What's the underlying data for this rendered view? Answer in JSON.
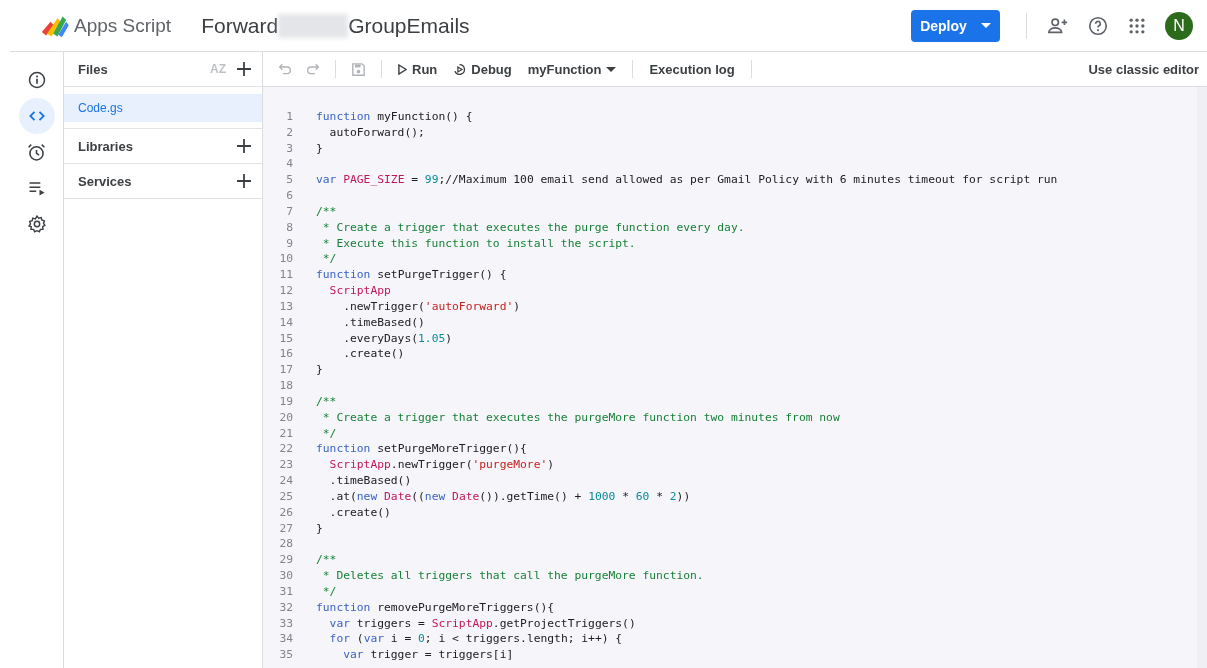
{
  "header": {
    "app_name": "Apps Script",
    "project_title_parts": [
      "Forward",
      "GroupEmails"
    ],
    "deploy_button": "Deploy",
    "avatar_initial": "N"
  },
  "rail": [
    {
      "kind": "info",
      "selected": false
    },
    {
      "kind": "code",
      "selected": true
    },
    {
      "kind": "triggers",
      "selected": false
    },
    {
      "kind": "executions",
      "selected": false
    },
    {
      "kind": "settings",
      "selected": false
    }
  ],
  "files_panel": {
    "title": "Files",
    "sort_label": "AZ",
    "files": [
      {
        "name": "Code.gs",
        "selected": true
      }
    ],
    "sections": [
      "Libraries",
      "Services"
    ]
  },
  "toolbar": {
    "run": "Run",
    "debug": "Debug",
    "function_select": "myFunction",
    "execution_log": "Execution log",
    "classic_editor": "Use classic editor"
  },
  "code_lines": [
    {
      "n": "1",
      "tokens": [
        {
          "kind": "kw",
          "text": "function"
        },
        {
          "kind": "plain",
          "text": " myFunction() {"
        }
      ]
    },
    {
      "n": "2",
      "tokens": [
        {
          "kind": "plain",
          "text": "  autoForward();"
        }
      ]
    },
    {
      "n": "3",
      "tokens": [
        {
          "kind": "plain",
          "text": "}"
        }
      ]
    },
    {
      "n": "4"
    },
    {
      "n": "5",
      "tokens": [
        {
          "kind": "kw",
          "text": "var "
        },
        {
          "kind": "cls",
          "text": "PAGE_SIZE"
        },
        {
          "kind": "plain",
          "text": " = "
        },
        {
          "kind": "num",
          "text": "99"
        },
        {
          "kind": "plain",
          "text": ";"
        },
        {
          "kind": "plaincomment",
          "text": "//Maximum 100 email send allowed as per Gmail Policy with 6 minutes timeout for script run"
        }
      ]
    },
    {
      "n": "6"
    },
    {
      "n": "7",
      "tokens": [
        {
          "kind": "comment",
          "text": "/**"
        }
      ]
    },
    {
      "n": "8",
      "tokens": [
        {
          "kind": "comment",
          "text": " * Create a trigger that executes the purge function every day."
        }
      ]
    },
    {
      "n": "9",
      "tokens": [
        {
          "kind": "comment",
          "text": " * Execute this function to install the script."
        }
      ]
    },
    {
      "n": "10",
      "tokens": [
        {
          "kind": "comment",
          "text": " */"
        }
      ]
    },
    {
      "n": "11",
      "tokens": [
        {
          "kind": "kw",
          "text": "function"
        },
        {
          "kind": "plain",
          "text": " setPurgeTrigger() {"
        }
      ]
    },
    {
      "n": "12",
      "tokens": [
        {
          "kind": "cls",
          "text": "  ScriptApp"
        }
      ]
    },
    {
      "n": "13",
      "tokens": [
        {
          "kind": "plain",
          "text": "    .newTrigger("
        },
        {
          "kind": "str",
          "text": "'autoForward'"
        },
        {
          "kind": "plain",
          "text": ")"
        }
      ]
    },
    {
      "n": "14",
      "tokens": [
        {
          "kind": "plain",
          "text": "    .timeBased()"
        }
      ]
    },
    {
      "n": "15",
      "tokens": [
        {
          "kind": "plain",
          "text": "    .everyDays("
        },
        {
          "kind": "num",
          "text": "1.05"
        },
        {
          "kind": "plain",
          "text": ")"
        }
      ]
    },
    {
      "n": "16",
      "tokens": [
        {
          "kind": "plain",
          "text": "    .create()"
        }
      ]
    },
    {
      "n": "17",
      "tokens": [
        {
          "kind": "plain",
          "text": "}"
        }
      ]
    },
    {
      "n": "18"
    },
    {
      "n": "19",
      "tokens": [
        {
          "kind": "comment",
          "text": "/**"
        }
      ]
    },
    {
      "n": "20",
      "tokens": [
        {
          "kind": "comment",
          "text": " * Create a trigger that executes the purgeMore function two minutes from now"
        }
      ]
    },
    {
      "n": "21",
      "tokens": [
        {
          "kind": "comment",
          "text": " */"
        }
      ]
    },
    {
      "n": "22",
      "tokens": [
        {
          "kind": "kw",
          "text": "function"
        },
        {
          "kind": "plain",
          "text": " setPurgeMoreTrigger(){"
        }
      ]
    },
    {
      "n": "23",
      "tokens": [
        {
          "kind": "cls",
          "text": "  ScriptApp"
        },
        {
          "kind": "plain",
          "text": ".newTrigger("
        },
        {
          "kind": "str",
          "text": "'purgeMore'"
        },
        {
          "kind": "plain",
          "text": ")"
        }
      ]
    },
    {
      "n": "24",
      "tokens": [
        {
          "kind": "plain",
          "text": "  .timeBased()"
        }
      ]
    },
    {
      "n": "25",
      "tokens": [
        {
          "kind": "plain",
          "text": "  .at("
        },
        {
          "kind": "kw",
          "text": "new "
        },
        {
          "kind": "cls",
          "text": "Date"
        },
        {
          "kind": "plain",
          "text": "(("
        },
        {
          "kind": "kw",
          "text": "new "
        },
        {
          "kind": "cls",
          "text": "Date"
        },
        {
          "kind": "plain",
          "text": "()).getTime() + "
        },
        {
          "kind": "num",
          "text": "1000"
        },
        {
          "kind": "plain",
          "text": " * "
        },
        {
          "kind": "num",
          "text": "60"
        },
        {
          "kind": "plain",
          "text": " * "
        },
        {
          "kind": "num",
          "text": "2"
        },
        {
          "kind": "plain",
          "text": "))"
        }
      ]
    },
    {
      "n": "26",
      "tokens": [
        {
          "kind": "plain",
          "text": "  .create()"
        }
      ]
    },
    {
      "n": "27",
      "tokens": [
        {
          "kind": "plain",
          "text": "}"
        }
      ]
    },
    {
      "n": "28"
    },
    {
      "n": "29",
      "tokens": [
        {
          "kind": "comment",
          "text": "/**"
        }
      ]
    },
    {
      "n": "30",
      "tokens": [
        {
          "kind": "comment",
          "text": " * Deletes all triggers that call the purgeMore function."
        }
      ]
    },
    {
      "n": "31",
      "tokens": [
        {
          "kind": "comment",
          "text": " */"
        }
      ]
    },
    {
      "n": "32",
      "tokens": [
        {
          "kind": "kw",
          "text": "function"
        },
        {
          "kind": "plain",
          "text": " removePurgeMoreTriggers(){"
        }
      ]
    },
    {
      "n": "33",
      "tokens": [
        {
          "kind": "kw",
          "text": "  var"
        },
        {
          "kind": "plain",
          "text": " triggers = "
        },
        {
          "kind": "cls",
          "text": "ScriptApp"
        },
        {
          "kind": "plain",
          "text": ".getProjectTriggers()"
        }
      ]
    },
    {
      "n": "34",
      "tokens": [
        {
          "kind": "kw",
          "text": "  for"
        },
        {
          "kind": "plain",
          "text": " ("
        },
        {
          "kind": "kw",
          "text": "var"
        },
        {
          "kind": "plain",
          "text": " i = "
        },
        {
          "kind": "num",
          "text": "0"
        },
        {
          "kind": "plain",
          "text": "; i < triggers.length; i++) {"
        }
      ]
    },
    {
      "n": "35",
      "tokens": [
        {
          "kind": "kw",
          "text": "    var"
        },
        {
          "kind": "plain",
          "text": " trigger = triggers[i]"
        }
      ]
    }
  ]
}
